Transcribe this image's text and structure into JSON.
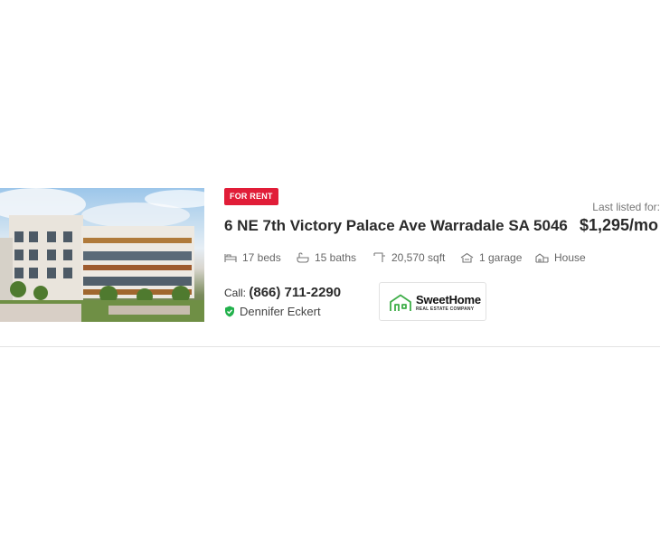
{
  "listing": {
    "badge": "FOR RENT",
    "title": "6 NE 7th Victory Palace Ave Warradale SA 5046",
    "last_listed_label": "Last listed for:",
    "price": "$1,295/mo",
    "photo_icon": "apartment-building-photo",
    "features": {
      "beds": "17 beds",
      "baths": "15 baths",
      "sqft": "20,570 sqft",
      "garage": "1 garage",
      "type": "House"
    },
    "call_label": "Call:",
    "phone": "(866) 711-2290",
    "agent_name": "Dennifer Eckert",
    "logo": {
      "name": "SweetHome",
      "tagline": "REAL ESTATE COMPANY"
    }
  },
  "colors": {
    "badge": "#e11d38",
    "verified": "#22b14c",
    "logo_accent": "#3fae49"
  }
}
